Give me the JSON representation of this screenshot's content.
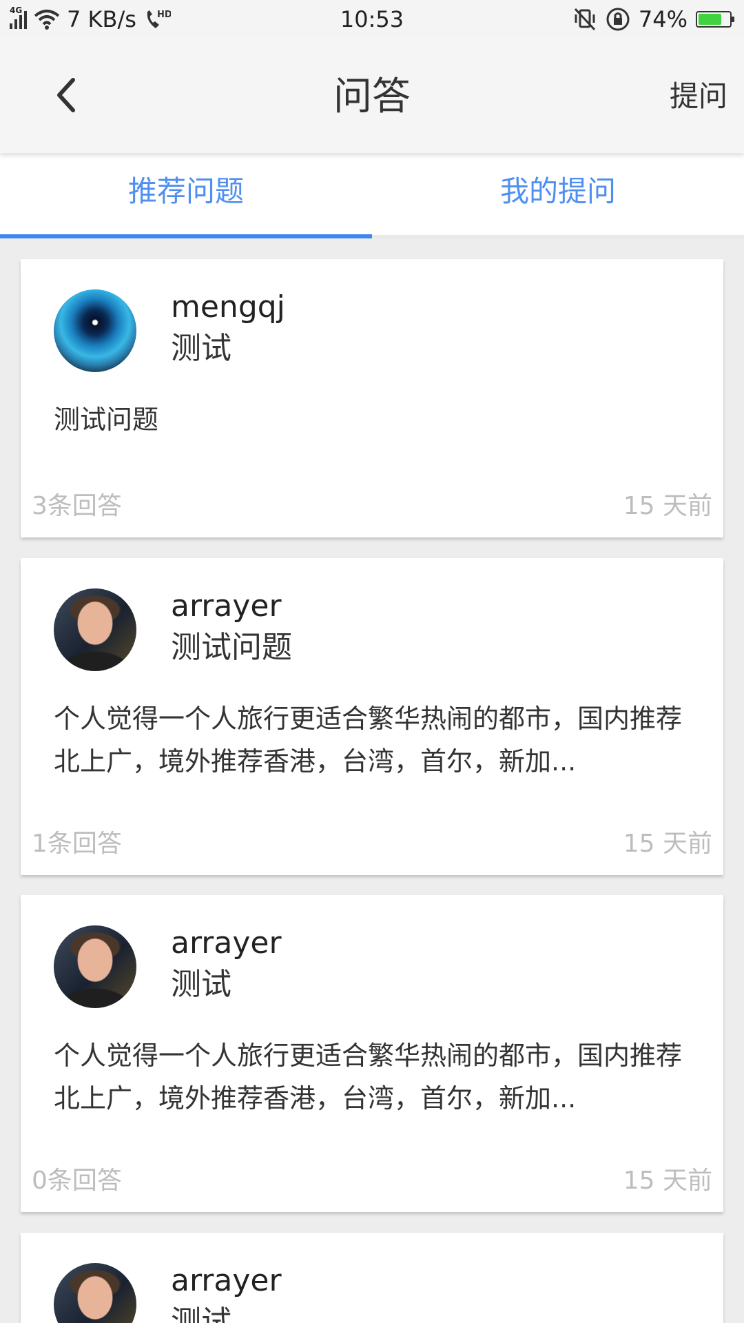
{
  "status_bar": {
    "network": "4G",
    "speed": "7 KB/s",
    "hd_label": "HD",
    "time": "10:53",
    "battery_text": "74%",
    "battery_level": 0.74,
    "battery_color": "#3fd43f"
  },
  "header": {
    "title": "问答",
    "ask_label": "提问"
  },
  "tabs": [
    {
      "label": "推荐问题",
      "active": true
    },
    {
      "label": "我的提问",
      "active": false
    }
  ],
  "colors": {
    "accent": "#3c87ee",
    "tab_text": "#4f8ff0",
    "meta_text": "#bdbdbd"
  },
  "questions": [
    {
      "author": "mengqj",
      "title": "测试",
      "content": "测试问题",
      "answers": "3条回答",
      "time": "15 天前",
      "avatar": "eye-avatar"
    },
    {
      "author": "arrayer",
      "title": "测试问题",
      "content": "个人觉得一个人旅行更适合繁华热闹的都市，国内推荐北上广，境外推荐香港，台湾，首尔，新加...",
      "answers": "1条回答",
      "time": "15 天前",
      "avatar": "person-avatar"
    },
    {
      "author": "arrayer",
      "title": "测试",
      "content": "个人觉得一个人旅行更适合繁华热闹的都市，国内推荐北上广，境外推荐香港，台湾，首尔，新加...",
      "answers": "0条回答",
      "time": "15 天前",
      "avatar": "person-avatar"
    },
    {
      "author": "arrayer",
      "title": "测试",
      "avatar": "person-avatar"
    }
  ]
}
